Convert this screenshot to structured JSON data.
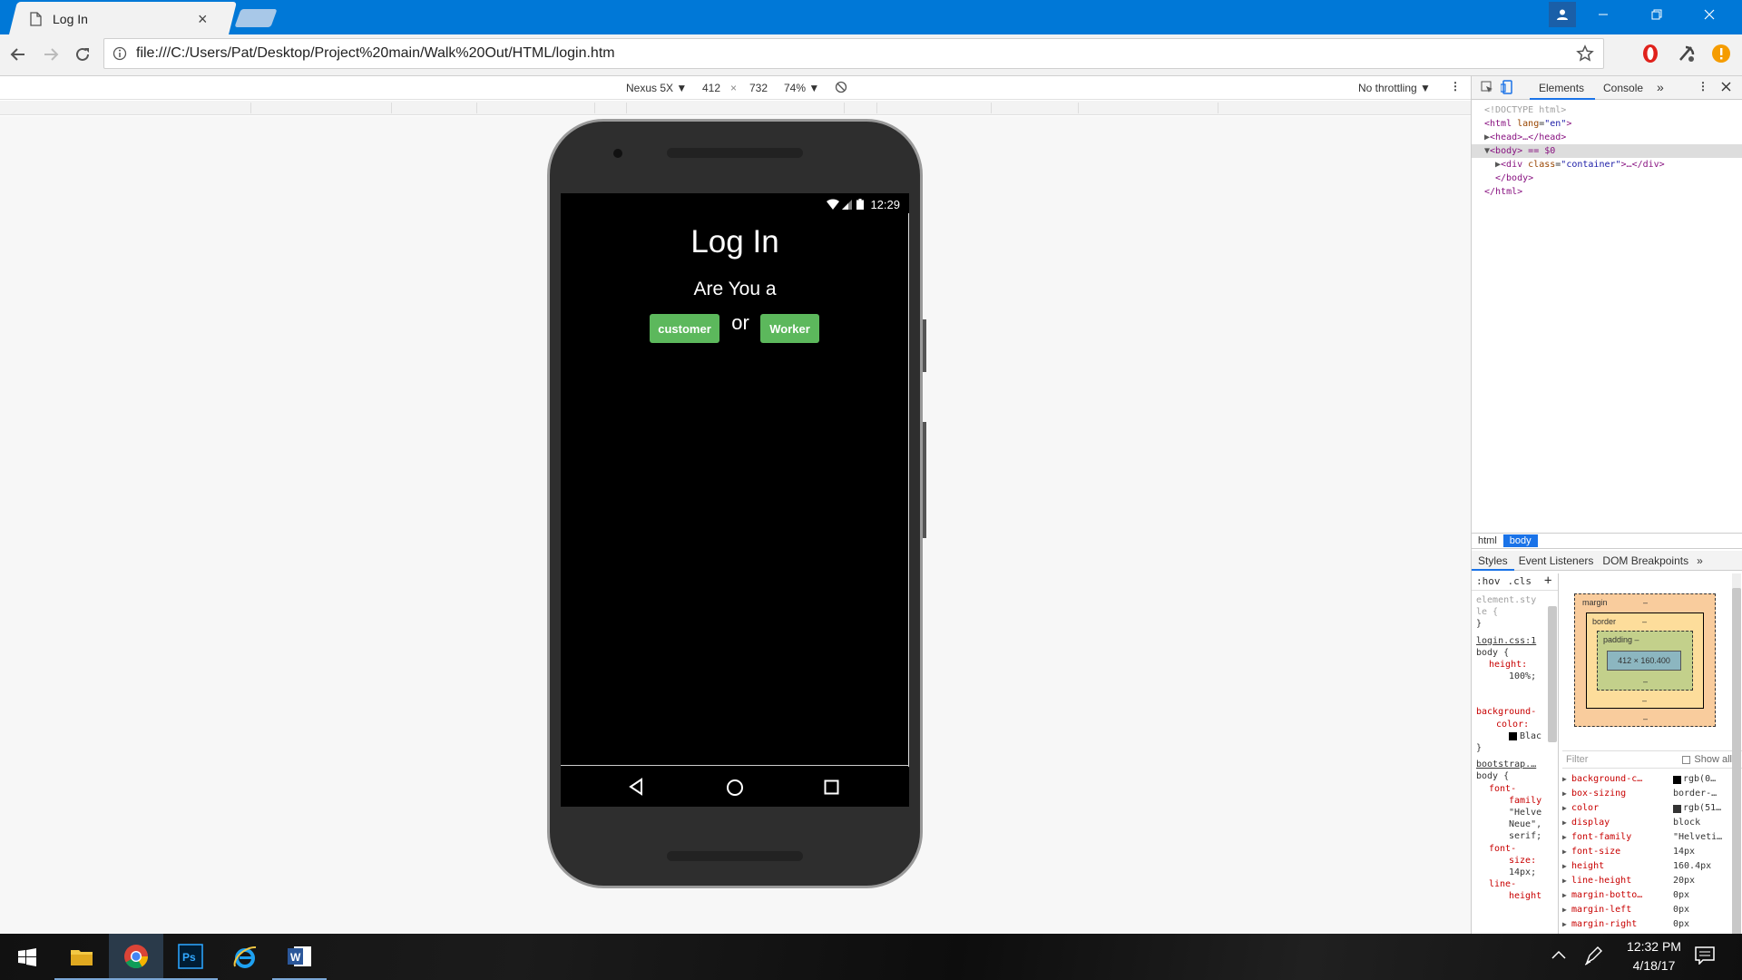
{
  "browser": {
    "tab_title": "Log In",
    "tab_close": "×",
    "url": "file:///C:/Users/Pat/Desktop/Project%20main/Walk%20Out/HTML/login.htm"
  },
  "device_toolbar": {
    "device": "Nexus 5X ▼",
    "width": "412",
    "times": "×",
    "height": "732",
    "zoom": "74% ▼",
    "throttling": "No throttling ▼"
  },
  "phone": {
    "status_time": "12:29",
    "app": {
      "heading": "Log In",
      "question": "Are You a",
      "customer_button": "customer",
      "or_text": "or",
      "worker_button": "Worker",
      "button_color": "#5cb85c",
      "background": "#000000"
    }
  },
  "devtools": {
    "tabs": [
      "Elements",
      "Console"
    ],
    "more": "»",
    "dom": {
      "doctype": "<!DOCTYPE html>",
      "html_open_tag": "<html",
      "html_attr": "lang",
      "html_attr_val": "\"en\"",
      "head": "<head>…</head>",
      "body": "<body> == $0",
      "div_tag": "<div",
      "div_attr": "class",
      "div_attr_val": "\"container\"",
      "div_close": ">…</div>",
      "body_close": "</body>",
      "html_close": "</html>"
    },
    "breadcrumb": [
      "html",
      "body"
    ],
    "styles_tabs": [
      "Styles",
      "Event Listeners",
      "DOM Breakpoints"
    ],
    "filter_pseudo": ":hov",
    "filter_cls": ".cls",
    "add_rule": "+",
    "styles": {
      "element_style_1": "element.sty",
      "element_style_2": "le {",
      "element_style_close": "}",
      "login_src": "login.css:1",
      "login_sel": "body {",
      "login_prop1": "height:",
      "login_val1": "100%;",
      "login_prop2a": "background-",
      "login_prop2b": "color:",
      "login_val2": "Blac",
      "login_close": "}",
      "bootstrap_src": "bootstrap.…",
      "bootstrap_sel": "body {",
      "bs_prop1a": "font-",
      "bs_prop1b": "family",
      "bs_val1a": "\"Helve",
      "bs_val1b": "Neue\",",
      "bs_val1c": "serif;",
      "bs_prop2a": "font-",
      "bs_prop2b": "size:",
      "bs_val2": "14px;",
      "bs_prop3a": "line-",
      "bs_prop3b": "height"
    },
    "box_model": {
      "margin": "margin",
      "border": "border",
      "padding": "padding –",
      "content": "412 × 160.400",
      "dash": "–"
    },
    "computed_filter": "Filter",
    "show_all": "Show all",
    "computed": [
      {
        "prop": "background-c…",
        "val": "rgb(0…",
        "swatch": "#000000"
      },
      {
        "prop": "box-sizing",
        "val": "border-…",
        "swatch": ""
      },
      {
        "prop": "color",
        "val": "rgb(51…",
        "swatch": "#333333"
      },
      {
        "prop": "display",
        "val": "block",
        "swatch": ""
      },
      {
        "prop": "font-family",
        "val": "\"Helveti…",
        "swatch": ""
      },
      {
        "prop": "font-size",
        "val": "14px",
        "swatch": ""
      },
      {
        "prop": "height",
        "val": "160.4px",
        "swatch": ""
      },
      {
        "prop": "line-height",
        "val": "20px",
        "swatch": ""
      },
      {
        "prop": "margin-botto…",
        "val": "0px",
        "swatch": ""
      },
      {
        "prop": "margin-left",
        "val": "0px",
        "swatch": ""
      },
      {
        "prop": "margin-right",
        "val": "0px",
        "swatch": ""
      }
    ]
  },
  "taskbar": {
    "time": "12:32 PM",
    "date": "4/18/17"
  }
}
